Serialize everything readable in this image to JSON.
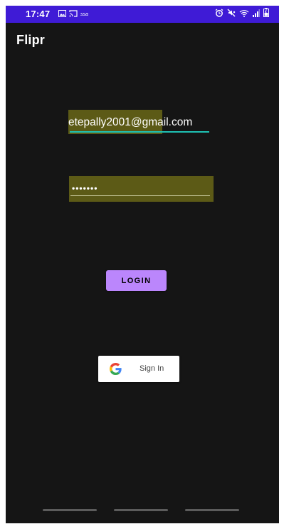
{
  "status_bar": {
    "time": "17:47",
    "small_text": "ssa",
    "color": "#3f1bd6"
  },
  "app_bar": {
    "title": "Flipr"
  },
  "login_form": {
    "email_value": "etepally2001@gmail.com",
    "password_value": "•••••••",
    "login_label": "LOGIN",
    "google_label": "Sign In",
    "accent_color": "#bb86fc",
    "field_underline_color": "#1fc1b3",
    "autofill_highlight_color": "#5c5a16"
  },
  "icons": {
    "status_left": [
      "gallery-icon",
      "cast-icon"
    ],
    "status_right": [
      "alarm-icon",
      "mute-icon",
      "wifi-icon",
      "signal-icon",
      "battery-icon"
    ],
    "google": "google-g-icon"
  }
}
